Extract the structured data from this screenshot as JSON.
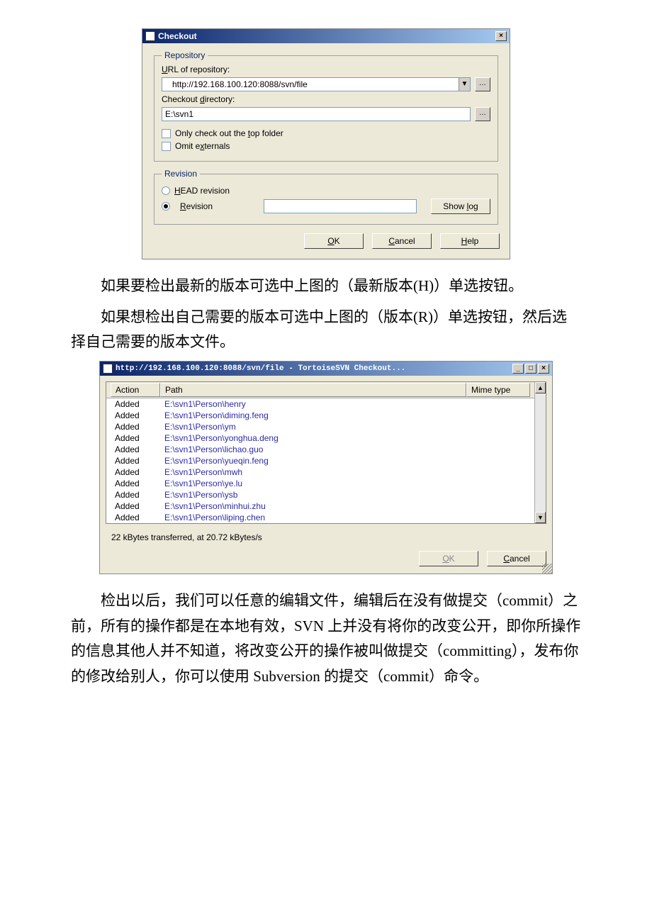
{
  "checkoutDialog": {
    "title": "Checkout",
    "repoGroup": "Repository",
    "urlLabel": "URL of repository:",
    "urlValue": "http://192.168.100.120:8088/svn/file",
    "dirLabel": "Checkout directory:",
    "dirValue": "E:\\svn1",
    "onlyTop": "Only check out the top folder",
    "omitExt": "Omit externals",
    "revGroup": "Revision",
    "headRev": "HEAD revision",
    "revLabel": "Revision",
    "showLog": "Show log",
    "ok": "OK",
    "cancel": "Cancel",
    "help": "Help"
  },
  "para1": "如果要检出最新的版本可选中上图的（最新版本(H)）单选按钮。",
  "para2": "如果想检出自己需要的版本可选中上图的（版本(R)）单选按钮，然后选择自己需要的版本文件。",
  "progressDialog": {
    "title": "http://192.168.100.120:8088/svn/file - TortoiseSVN Checkout...",
    "colAction": "Action",
    "colPath": "Path",
    "colMime": "Mime type",
    "rows": [
      {
        "action": "Added",
        "path": "E:\\svn1\\Person\\henry"
      },
      {
        "action": "Added",
        "path": "E:\\svn1\\Person\\diming.feng"
      },
      {
        "action": "Added",
        "path": "E:\\svn1\\Person\\ym"
      },
      {
        "action": "Added",
        "path": "E:\\svn1\\Person\\yonghua.deng"
      },
      {
        "action": "Added",
        "path": "E:\\svn1\\Person\\lichao.guo"
      },
      {
        "action": "Added",
        "path": "E:\\svn1\\Person\\yueqin.feng"
      },
      {
        "action": "Added",
        "path": "E:\\svn1\\Person\\mwh"
      },
      {
        "action": "Added",
        "path": "E:\\svn1\\Person\\ye.lu"
      },
      {
        "action": "Added",
        "path": "E:\\svn1\\Person\\ysb"
      },
      {
        "action": "Added",
        "path": "E:\\svn1\\Person\\minhui.zhu"
      },
      {
        "action": "Added",
        "path": "E:\\svn1\\Person\\liping.chen"
      }
    ],
    "status": "22 kBytes transferred, at 20.72 kBytes/s",
    "ok": "OK",
    "cancel": "Cancel"
  },
  "para3": "检出以后，我们可以任意的编辑文件，编辑后在没有做提交（commit）之前，所有的操作都是在本地有效，SVN 上并没有将你的改变公开，即你所操作的信息其他人并不知道，将改变公开的操作被叫做提交（committing），发布你的修改给别人，你可以使用 Subversion 的提交（commit）命令。"
}
